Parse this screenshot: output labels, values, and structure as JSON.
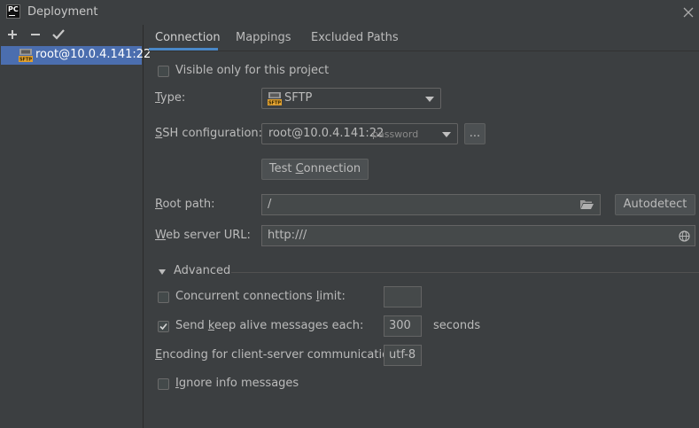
{
  "window": {
    "title": "Deployment",
    "app_icon_text": "PC"
  },
  "toolbar": {
    "add_icon": "plus-icon",
    "remove_icon": "minus-icon",
    "apply_icon": "check-icon"
  },
  "servers": [
    {
      "label": "root@10.0.4.141:22",
      "icon": "sftp-icon",
      "selected": true
    }
  ],
  "tabs": [
    {
      "label": "Connection",
      "active": true
    },
    {
      "label": "Mappings",
      "active": false
    },
    {
      "label": "Excluded Paths",
      "active": false
    }
  ],
  "connection": {
    "visible_only_label": "Visible only for this project",
    "visible_only_checked": false,
    "type_label": "Type:",
    "type_value": "SFTP",
    "ssh_label": "SSH configuration:",
    "ssh_value": "root@10.0.4.141:22",
    "ssh_auth": "password",
    "ssh_more_label": "...",
    "test_connection_label": "Test Connection",
    "root_path_label": "Root path:",
    "root_path_value": "/",
    "autodetect_label": "Autodetect",
    "web_url_label": "Web server URL:",
    "web_url_value": "http:///"
  },
  "advanced": {
    "title": "Advanced",
    "expanded": true,
    "concurrent_label": "Concurrent connections limit:",
    "concurrent_checked": false,
    "concurrent_value": "",
    "keepalive_label": "Send keep alive messages each:",
    "keepalive_checked": true,
    "keepalive_value": "300",
    "keepalive_unit": "seconds",
    "encoding_label": "Encoding for client-server communication:",
    "encoding_value": "utf-8",
    "ignore_label": "Ignore info messages",
    "ignore_checked": false
  },
  "colors": {
    "background": "#3c3f41",
    "selection": "#4b6eaf",
    "tab_underline": "#4a88c7",
    "text": "#bbbbbb"
  }
}
